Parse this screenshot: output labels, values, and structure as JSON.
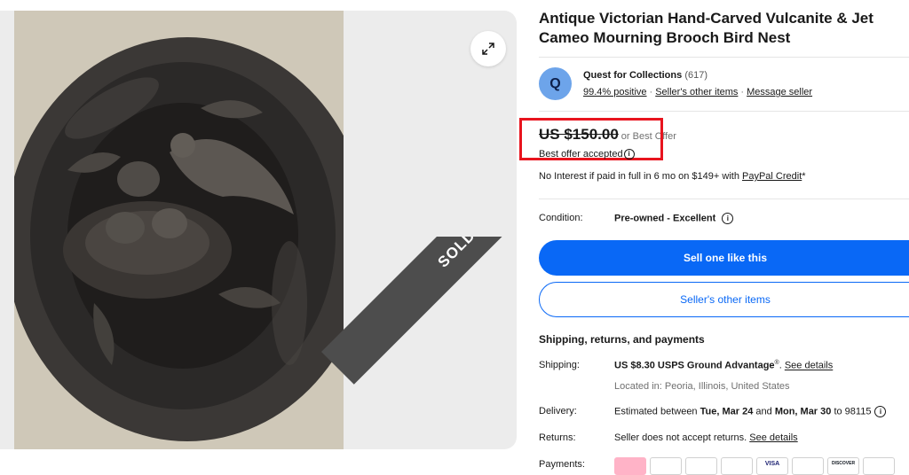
{
  "item": {
    "title": "Antique Victorian Hand-Carved Vulcanite & Jet Cameo Mourning Brooch Bird Nest",
    "sold_badge": "SOLD"
  },
  "seller": {
    "avatar_letter": "Q",
    "name": "Quest for Collections",
    "feedback_count": "(617)",
    "positive": "99.4% positive",
    "other_items_link": "Seller's other items",
    "message_link": "Message seller"
  },
  "price": {
    "amount": "US $150.00",
    "best_offer": "or Best Offer",
    "offer_accepted": "Best offer accepted",
    "financing_text": "No Interest if paid in full in 6 mo on $149+ with ",
    "financing_link": "PayPal Credit",
    "financing_suffix": "*"
  },
  "condition": {
    "label": "Condition:",
    "value": "Pre-owned - Excellent"
  },
  "buttons": {
    "sell_one": "Sell one like this",
    "sellers_other_items": "Seller's other items"
  },
  "shipping": {
    "heading": "Shipping, returns, and payments",
    "shipping_label": "Shipping:",
    "shipping_value": "US $8.30 USPS Ground Advantage",
    "shipping_sup": "®",
    "see_details": "See details",
    "location": "Located in: Peoria, Illinois, United States",
    "delivery_label": "Delivery:",
    "delivery_prefix": "Estimated between ",
    "delivery_date1": "Tue, Mar 24",
    "delivery_and": " and ",
    "delivery_date2": "Mon, Mar 30",
    "delivery_suffix": " to 98115",
    "returns_label": "Returns:",
    "returns_value": "Seller does not accept returns. ",
    "payments_label": "Payments:",
    "payment_logos": [
      "",
      "",
      "",
      "",
      "VISA",
      "",
      "DISCOVER",
      ""
    ]
  },
  "colors": {
    "primary": "#0968f6",
    "highlight_box": "#e8141e",
    "sold_ribbon": "#4d4d4d"
  }
}
